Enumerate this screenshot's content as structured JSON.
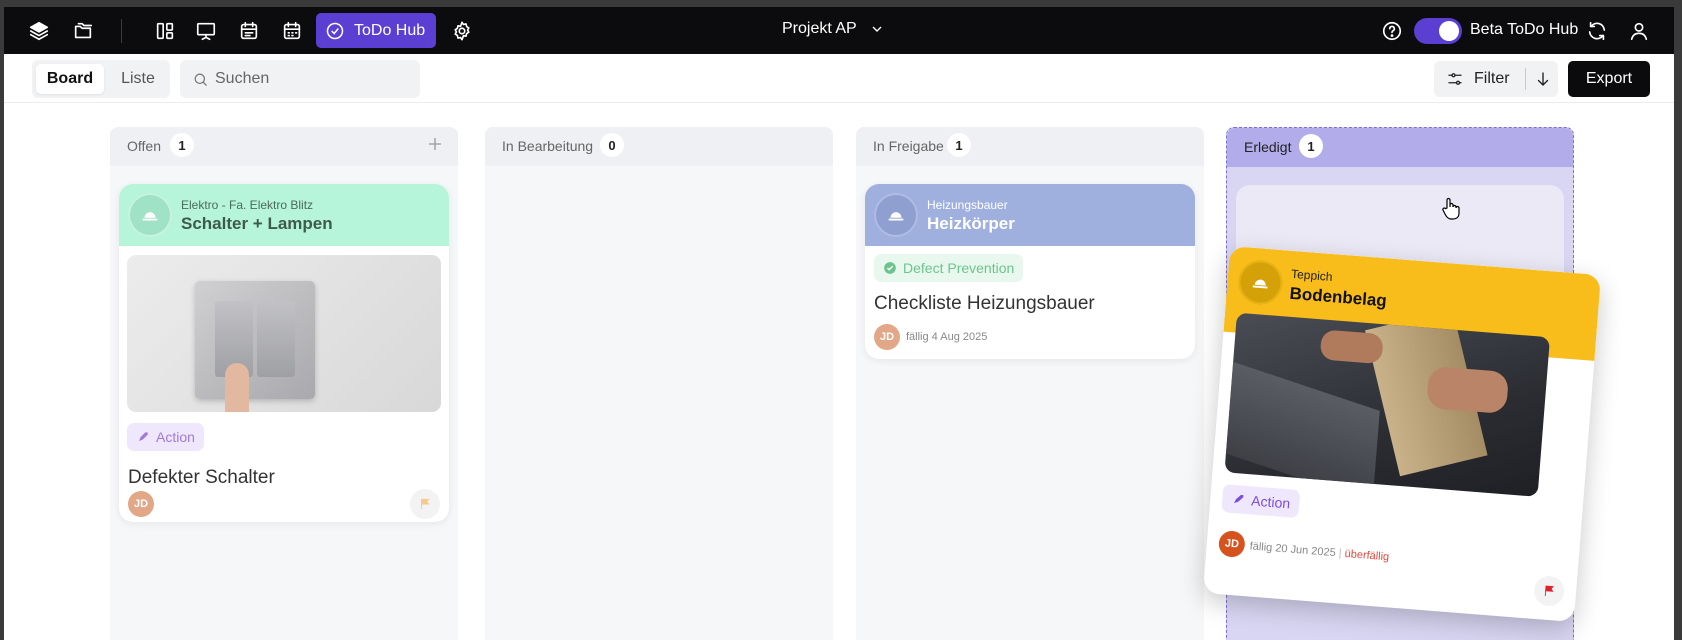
{
  "topbar": {
    "todo_hub_label": "ToDo Hub",
    "project_label": "Projekt AP",
    "beta_label": "Beta ToDo Hub"
  },
  "subbar": {
    "view_board": "Board",
    "view_list": "Liste",
    "search_placeholder": "Suchen",
    "filter_label": "Filter",
    "export_label": "Export"
  },
  "columns": [
    {
      "title": "Offen",
      "count": "1"
    },
    {
      "title": "In Bearbeitung",
      "count": "0"
    },
    {
      "title": "In Freigabe",
      "count": "1"
    },
    {
      "title": "Erledigt",
      "count": "1"
    }
  ],
  "cards": {
    "schalter": {
      "trade": "Elektro - Fa. Elektro Blitz",
      "topic": "Schalter + Lampen",
      "tag": "Action",
      "title": "Defekter Schalter",
      "assignee": "JD",
      "header_color": "#b6f5d9"
    },
    "heizkoerper": {
      "trade": "Heizungsbauer",
      "topic": "Heizkörper",
      "tag": "Defect Prevention",
      "title": "Checkliste Heizungsbauer",
      "assignee": "JD",
      "due": "fällig 4 Aug 2025",
      "header_color": "#9fb0df"
    },
    "bodenbelag": {
      "trade": "Teppich",
      "topic": "Bodenbelag",
      "tag": "Action",
      "assignee": "JD",
      "due": "fällig 20 Jun 2025",
      "overdue": "überfällig",
      "header_color": "#f8bd1a"
    }
  }
}
